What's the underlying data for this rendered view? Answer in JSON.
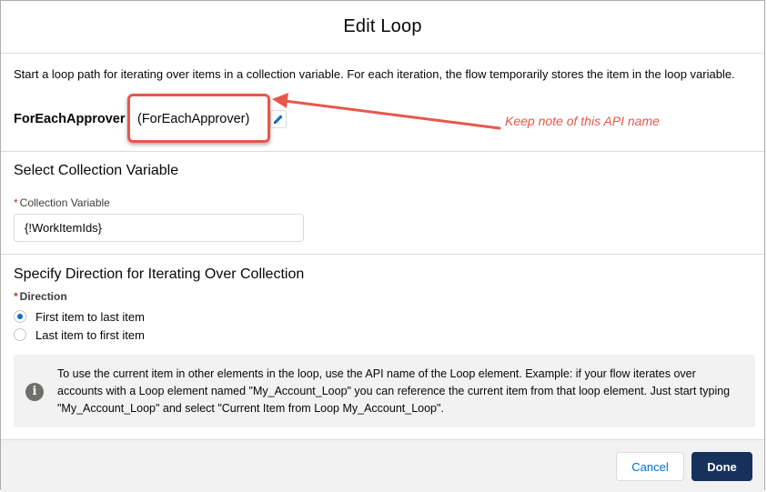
{
  "modal": {
    "title": "Edit Loop"
  },
  "loop": {
    "intro": "Start a loop path for iterating over items in a collection variable. For each iteration, the flow temporarily stores the item in the loop variable.",
    "label": "ForEachApprover",
    "api_name": "(ForEachApprover)"
  },
  "annotation": {
    "text": "Keep note of this API name",
    "color": "#e8574b"
  },
  "collection": {
    "section_title": "Select Collection Variable",
    "field_label": "Collection Variable",
    "required_mark": "*",
    "value": "{!WorkItemIds}"
  },
  "direction": {
    "section_title": "Specify Direction for Iterating Over Collection",
    "field_label": "Direction",
    "required_mark": "*",
    "options": [
      {
        "label": "First item to last item",
        "checked": true
      },
      {
        "label": "Last item to first item",
        "checked": false
      }
    ]
  },
  "info": {
    "text": "To use the current item in other elements in the loop, use the API name of the Loop element. Example: if your flow iterates over accounts with a Loop element named \"My_Account_Loop\" you can reference the current item from that loop element. Just start typing \"My_Account_Loop\" and select \"Current Item from Loop My_Account_Loop\"."
  },
  "footer": {
    "cancel_label": "Cancel",
    "done_label": "Done"
  },
  "colors": {
    "brand": "#0070d2",
    "primary_button": "#16325c",
    "required": "#c23934"
  },
  "icons": {
    "edit": "pencil-icon",
    "info": "info-icon"
  }
}
